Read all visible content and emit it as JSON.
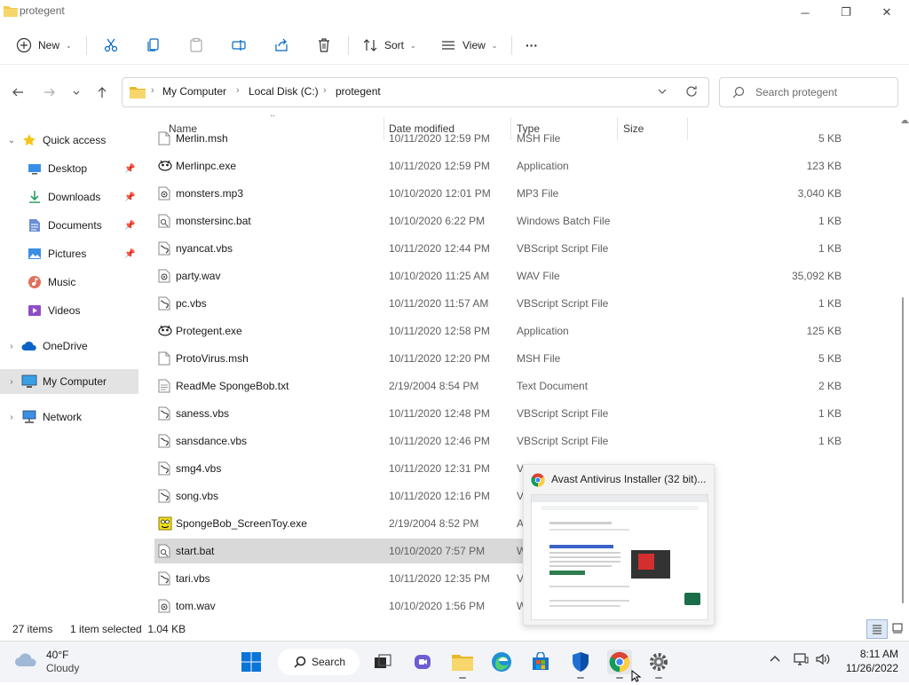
{
  "window": {
    "title": "protegent",
    "minimize_glyph": "─",
    "restore_glyph": "❐",
    "close_glyph": "✕"
  },
  "toolbar": {
    "new_label": "New",
    "sort_label": "Sort",
    "view_label": "View",
    "more_label": "···"
  },
  "address": {
    "crumbs": [
      "My Computer",
      "Local Disk (C:)",
      "protegent"
    ],
    "search_placeholder": "Search protegent"
  },
  "nav": {
    "items": [
      {
        "label": "Quick access",
        "icon": "star-icon"
      },
      {
        "label": "Desktop",
        "icon": "desktop-icon"
      },
      {
        "label": "Downloads",
        "icon": "download-icon"
      },
      {
        "label": "Documents",
        "icon": "document-icon"
      },
      {
        "label": "Pictures",
        "icon": "picture-icon"
      },
      {
        "label": "Music",
        "icon": "music-icon"
      },
      {
        "label": "Videos",
        "icon": "video-icon"
      },
      {
        "label": "OneDrive",
        "icon": "cloud-icon"
      },
      {
        "label": "My Computer",
        "icon": "computer-icon"
      },
      {
        "label": "Network",
        "icon": "network-icon"
      }
    ]
  },
  "columns": {
    "name": "Name",
    "date": "Date modified",
    "type": "Type",
    "size": "Size"
  },
  "files": [
    {
      "name": "Merlin.msh",
      "date": "10/11/2020 12:59 PM",
      "type": "MSH File",
      "size": "5 KB",
      "icon": "file-icon"
    },
    {
      "name": "Merlinpc.exe",
      "date": "10/11/2020 12:59 PM",
      "type": "Application",
      "size": "123 KB",
      "icon": "app-icon"
    },
    {
      "name": "monsters.mp3",
      "date": "10/10/2020 12:01 PM",
      "type": "MP3 File",
      "size": "3,040 KB",
      "icon": "audio-file-icon"
    },
    {
      "name": "monstersinc.bat",
      "date": "10/10/2020 6:22 PM",
      "type": "Windows Batch File",
      "size": "1 KB",
      "icon": "batch-file-icon"
    },
    {
      "name": "nyancat.vbs",
      "date": "10/11/2020 12:44 PM",
      "type": "VBScript Script File",
      "size": "1 KB",
      "icon": "script-file-icon"
    },
    {
      "name": "party.wav",
      "date": "10/10/2020 11:25 AM",
      "type": "WAV File",
      "size": "35,092 KB",
      "icon": "audio-file-icon"
    },
    {
      "name": "pc.vbs",
      "date": "10/11/2020 11:57 AM",
      "type": "VBScript Script File",
      "size": "1 KB",
      "icon": "script-file-icon"
    },
    {
      "name": "Protegent.exe",
      "date": "10/11/2020 12:58 PM",
      "type": "Application",
      "size": "125 KB",
      "icon": "app-icon"
    },
    {
      "name": "ProtoVirus.msh",
      "date": "10/11/2020 12:20 PM",
      "type": "MSH File",
      "size": "5 KB",
      "icon": "file-icon"
    },
    {
      "name": "ReadMe SpongeBob.txt",
      "date": "2/19/2004 8:54 PM",
      "type": "Text Document",
      "size": "2 KB",
      "icon": "text-file-icon"
    },
    {
      "name": "saness.vbs",
      "date": "10/11/2020 12:48 PM",
      "type": "VBScript Script File",
      "size": "1 KB",
      "icon": "script-file-icon"
    },
    {
      "name": "sansdance.vbs",
      "date": "10/11/2020 12:46 PM",
      "type": "VBScript Script File",
      "size": "1 KB",
      "icon": "script-file-icon"
    },
    {
      "name": "smg4.vbs",
      "date": "10/11/2020 12:31 PM",
      "type": "V",
      "size": "",
      "icon": "script-file-icon"
    },
    {
      "name": "song.vbs",
      "date": "10/11/2020 12:16 PM",
      "type": "V",
      "size": "",
      "icon": "script-file-icon"
    },
    {
      "name": "SpongeBob_ScreenToy.exe",
      "date": "2/19/2004 8:52 PM",
      "type": "A",
      "size": "",
      "icon": "spongebob-app-icon"
    },
    {
      "name": "start.bat",
      "date": "10/10/2020 7:57 PM",
      "type": "W",
      "size": "",
      "icon": "batch-file-icon",
      "selected": true
    },
    {
      "name": "tari.vbs",
      "date": "10/11/2020 12:35 PM",
      "type": "V",
      "size": "",
      "icon": "script-file-icon"
    },
    {
      "name": "tom.wav",
      "date": "10/10/2020 1:56 PM",
      "type": "W",
      "size": "",
      "icon": "audio-file-icon"
    }
  ],
  "status": {
    "item_count": "27 items",
    "selection": "1 item selected  1.04 KB"
  },
  "preview": {
    "title": "Avast Antivirus Installer (32 bit)..."
  },
  "taskbar": {
    "weather_temp": "40°F",
    "weather_desc": "Cloudy",
    "search_label": "Search",
    "time": "8:11 AM",
    "date": "11/26/2022"
  },
  "colors": {
    "accent": "#0067c0",
    "folder": "#f2c94c",
    "selected_row": "#d9d9d9"
  }
}
